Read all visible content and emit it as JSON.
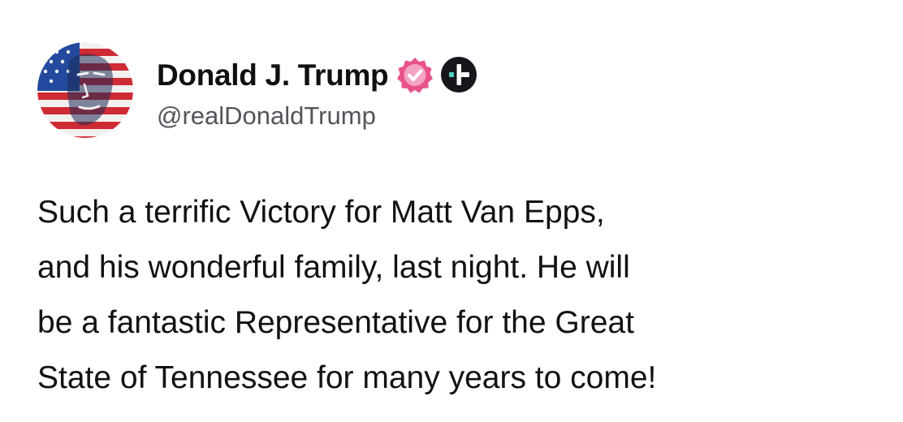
{
  "post": {
    "author": {
      "display_name": "Donald J. Trump",
      "handle": "@realDonaldTrump",
      "avatar_icon": "flag-portrait-avatar",
      "verified_icon": "verified-badge-icon",
      "extra_badge_icon": "plus-badge-icon"
    },
    "body_lines": [
      "Such a terrific Victory for Matt Van Epps,",
      "and his wonderful family, last night. He will",
      "be a fantastic Representative for the Great",
      "State of Tennessee for many years to come!"
    ]
  },
  "colors": {
    "verified_badge": "#e8528a",
    "plus_badge_bg": "#16161c",
    "handle_text": "#54545c",
    "body_text": "#111116"
  }
}
